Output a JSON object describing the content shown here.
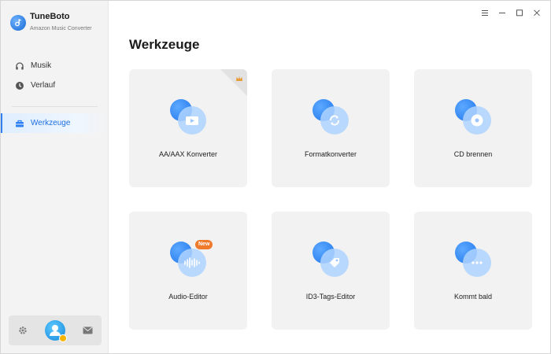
{
  "app": {
    "name": "TuneBoto",
    "subtitle": "Amazon Music Converter"
  },
  "sidebar": {
    "items": [
      {
        "label": "Musik",
        "icon": "headphones-icon"
      },
      {
        "label": "Verlauf",
        "icon": "clock-icon"
      },
      {
        "label": "Werkzeuge",
        "icon": "toolbox-icon",
        "active": true
      }
    ],
    "bottom": {
      "settings_icon": "gear-icon",
      "avatar_icon": "user-avatar",
      "mail_icon": "mail-icon"
    }
  },
  "window_controls": [
    "menu-icon",
    "minimize-icon",
    "maximize-icon",
    "close-icon"
  ],
  "main": {
    "title": "Werkzeuge",
    "tools": [
      {
        "label": "AA/AAX Konverter",
        "icon": "video-file-icon"
      },
      {
        "label": "Formatkonverter",
        "icon": "convert-icon"
      },
      {
        "label": "CD brennen",
        "icon": "cd-icon"
      },
      {
        "label": "Audio-Editor",
        "icon": "waveform-icon",
        "badge": "New"
      },
      {
        "label": "ID3-Tags-Editor",
        "icon": "tag-icon"
      },
      {
        "label": "Kommt bald",
        "icon": "more-icon"
      }
    ]
  },
  "colors": {
    "accent": "#2d7ff3",
    "sidebar_bg": "#f3f3f3",
    "card_bg": "#f2f2f2",
    "new_badge": "#f07a2c"
  }
}
